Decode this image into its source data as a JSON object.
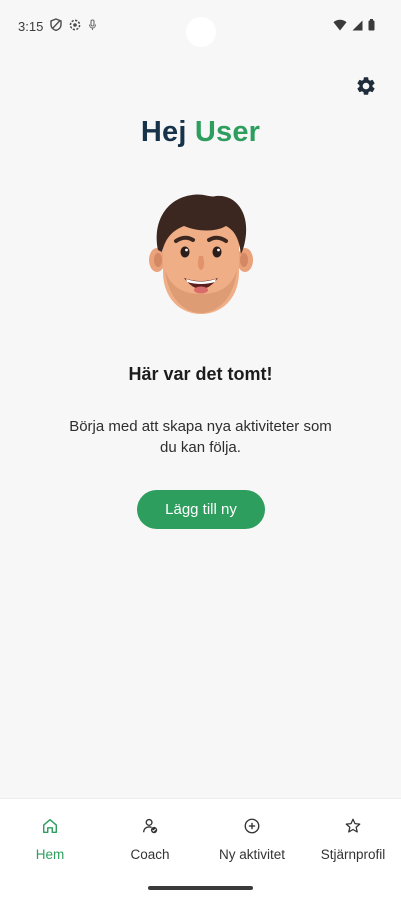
{
  "status_bar": {
    "time": "3:15",
    "left_icons": [
      "shield-icon",
      "settings-circle-icon",
      "mic-icon"
    ],
    "right_icons": [
      "wifi-icon",
      "signal-icon",
      "battery-icon"
    ]
  },
  "header": {
    "settings_icon": "gear-icon"
  },
  "greeting": {
    "hello": "Hej",
    "name": "User"
  },
  "empty_state": {
    "title": "Här var det tomt!",
    "description": "Börja med att skapa nya aktiviteter som du kan följa.",
    "button_label": "Lägg till ny"
  },
  "bottom_nav": {
    "items": [
      {
        "label": "Hem",
        "icon": "home-icon",
        "active": true
      },
      {
        "label": "Coach",
        "icon": "coach-icon",
        "active": false
      },
      {
        "label": "Ny aktivitet",
        "icon": "plus-circle-icon",
        "active": false
      },
      {
        "label": "Stjärnprofil",
        "icon": "star-icon",
        "active": false
      }
    ]
  },
  "colors": {
    "accent": "#2e9e5e",
    "heading_dark": "#16334a",
    "background": "#f7f7f7"
  }
}
